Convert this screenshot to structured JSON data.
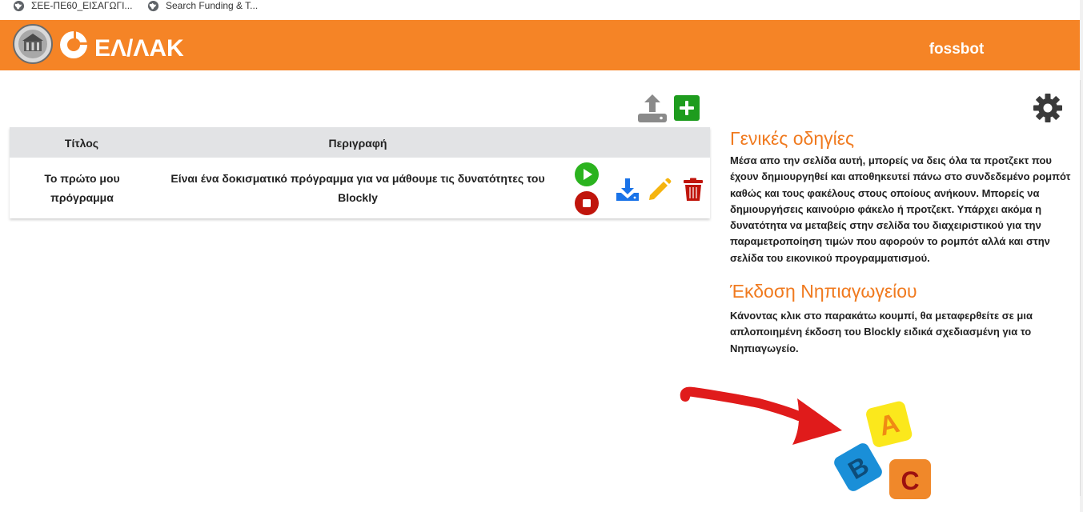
{
  "bookmarks": [
    {
      "label": "ΣΕΕ-ΠΕ60_ΕΙΣΑΓΩΓΙ..."
    },
    {
      "label": "Search Funding & T..."
    }
  ],
  "header": {
    "logo_text": "ΕΛ/ΛΑΚ",
    "username": "fossbot",
    "background_color": "#f58426"
  },
  "table": {
    "columns": [
      "Τίτλος",
      "Περιγραφή"
    ],
    "rows": [
      {
        "title": "Το πρώτο μου πρόγραμμα",
        "description": "Είναι ένα δοκισματικό πρόγραμμα για να μάθουμε τις δυνατότητες του Blockly"
      }
    ],
    "row_icons": [
      "play-icon",
      "stop-icon",
      "download-icon",
      "pencil-icon",
      "trash-icon"
    ]
  },
  "toolbar": {
    "icons": [
      "upload-icon",
      "plus-icon"
    ]
  },
  "sidebar": {
    "sections": [
      {
        "title": "Γενικές οδηγίες",
        "body": "Μέσα απο την σελίδα αυτή, μπορείς να δεις όλα τα προτζεκτ που έχουν δημιουργηθεί και αποθηκευτεί πάνω στο συνδεδεμένο ρομπότ καθώς και τους φακέλους στους οποίους ανήκουν. Μπορείς να δημιουργήσεις καινούριο φάκελο ή προτζεκτ. Υπάρχει ακόμα η δυνατότητα να μεταβείς στην σελίδα του διαχειριστικού για την παραμετροποίηση τιμών που αφορούν το ρομπότ αλλά και στην σελίδα του εικονικού προγραμματισμού."
      },
      {
        "title": "Έκδοση Νηπιαγωγείου",
        "body": "Κάνοντας κλικ στο παρακάτω κουμπί, θα μεταφερθείτε σε μια απλοποιημένη έκδοση του Blockly ειδικά σχεδιασμένη για το Νηπιαγωγείο."
      }
    ],
    "accent_color": "#f07a1f"
  },
  "kindergarten_button": {
    "letters": [
      "A",
      "B",
      "C"
    ]
  }
}
